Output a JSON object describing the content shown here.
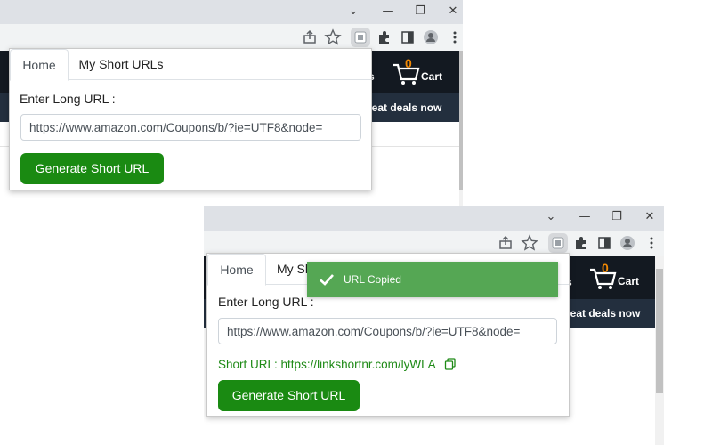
{
  "window_controls": {
    "dropdown": "⌄",
    "minimize": "—",
    "restore": "❐",
    "close": "✕"
  },
  "site": {
    "cart_count": "0",
    "cart_label": "Cart",
    "nav_fragment": "s",
    "subnav_text": "reat deals now"
  },
  "popup": {
    "tabs": [
      "Home",
      "My Short URLs"
    ],
    "tab_partial": "My Sh",
    "input_label": "Enter Long URL :",
    "long_url_value": "https://www.amazon.com/Coupons/b/?ie=UTF8&node=",
    "generate_label": "Generate Short URL",
    "short_url_label": "Short URL:",
    "short_url_value": "https://linkshortnr.com/lyWLA"
  },
  "toast": {
    "text": "URL Copied"
  },
  "colors": {
    "primary_button": "#1a8a12",
    "short_url_text": "#1e8a16",
    "toast_bg": "#55a754",
    "site_header": "#131921",
    "cart_count": "#f08804"
  },
  "icons": [
    "chevron-down-icon",
    "minimize-icon",
    "restore-icon",
    "close-icon",
    "share-icon",
    "star-icon",
    "extension-icon",
    "puzzle-icon",
    "side-panel-icon",
    "profile-icon",
    "more-vert-icon",
    "cart-icon",
    "check-icon",
    "copy-icon"
  ]
}
